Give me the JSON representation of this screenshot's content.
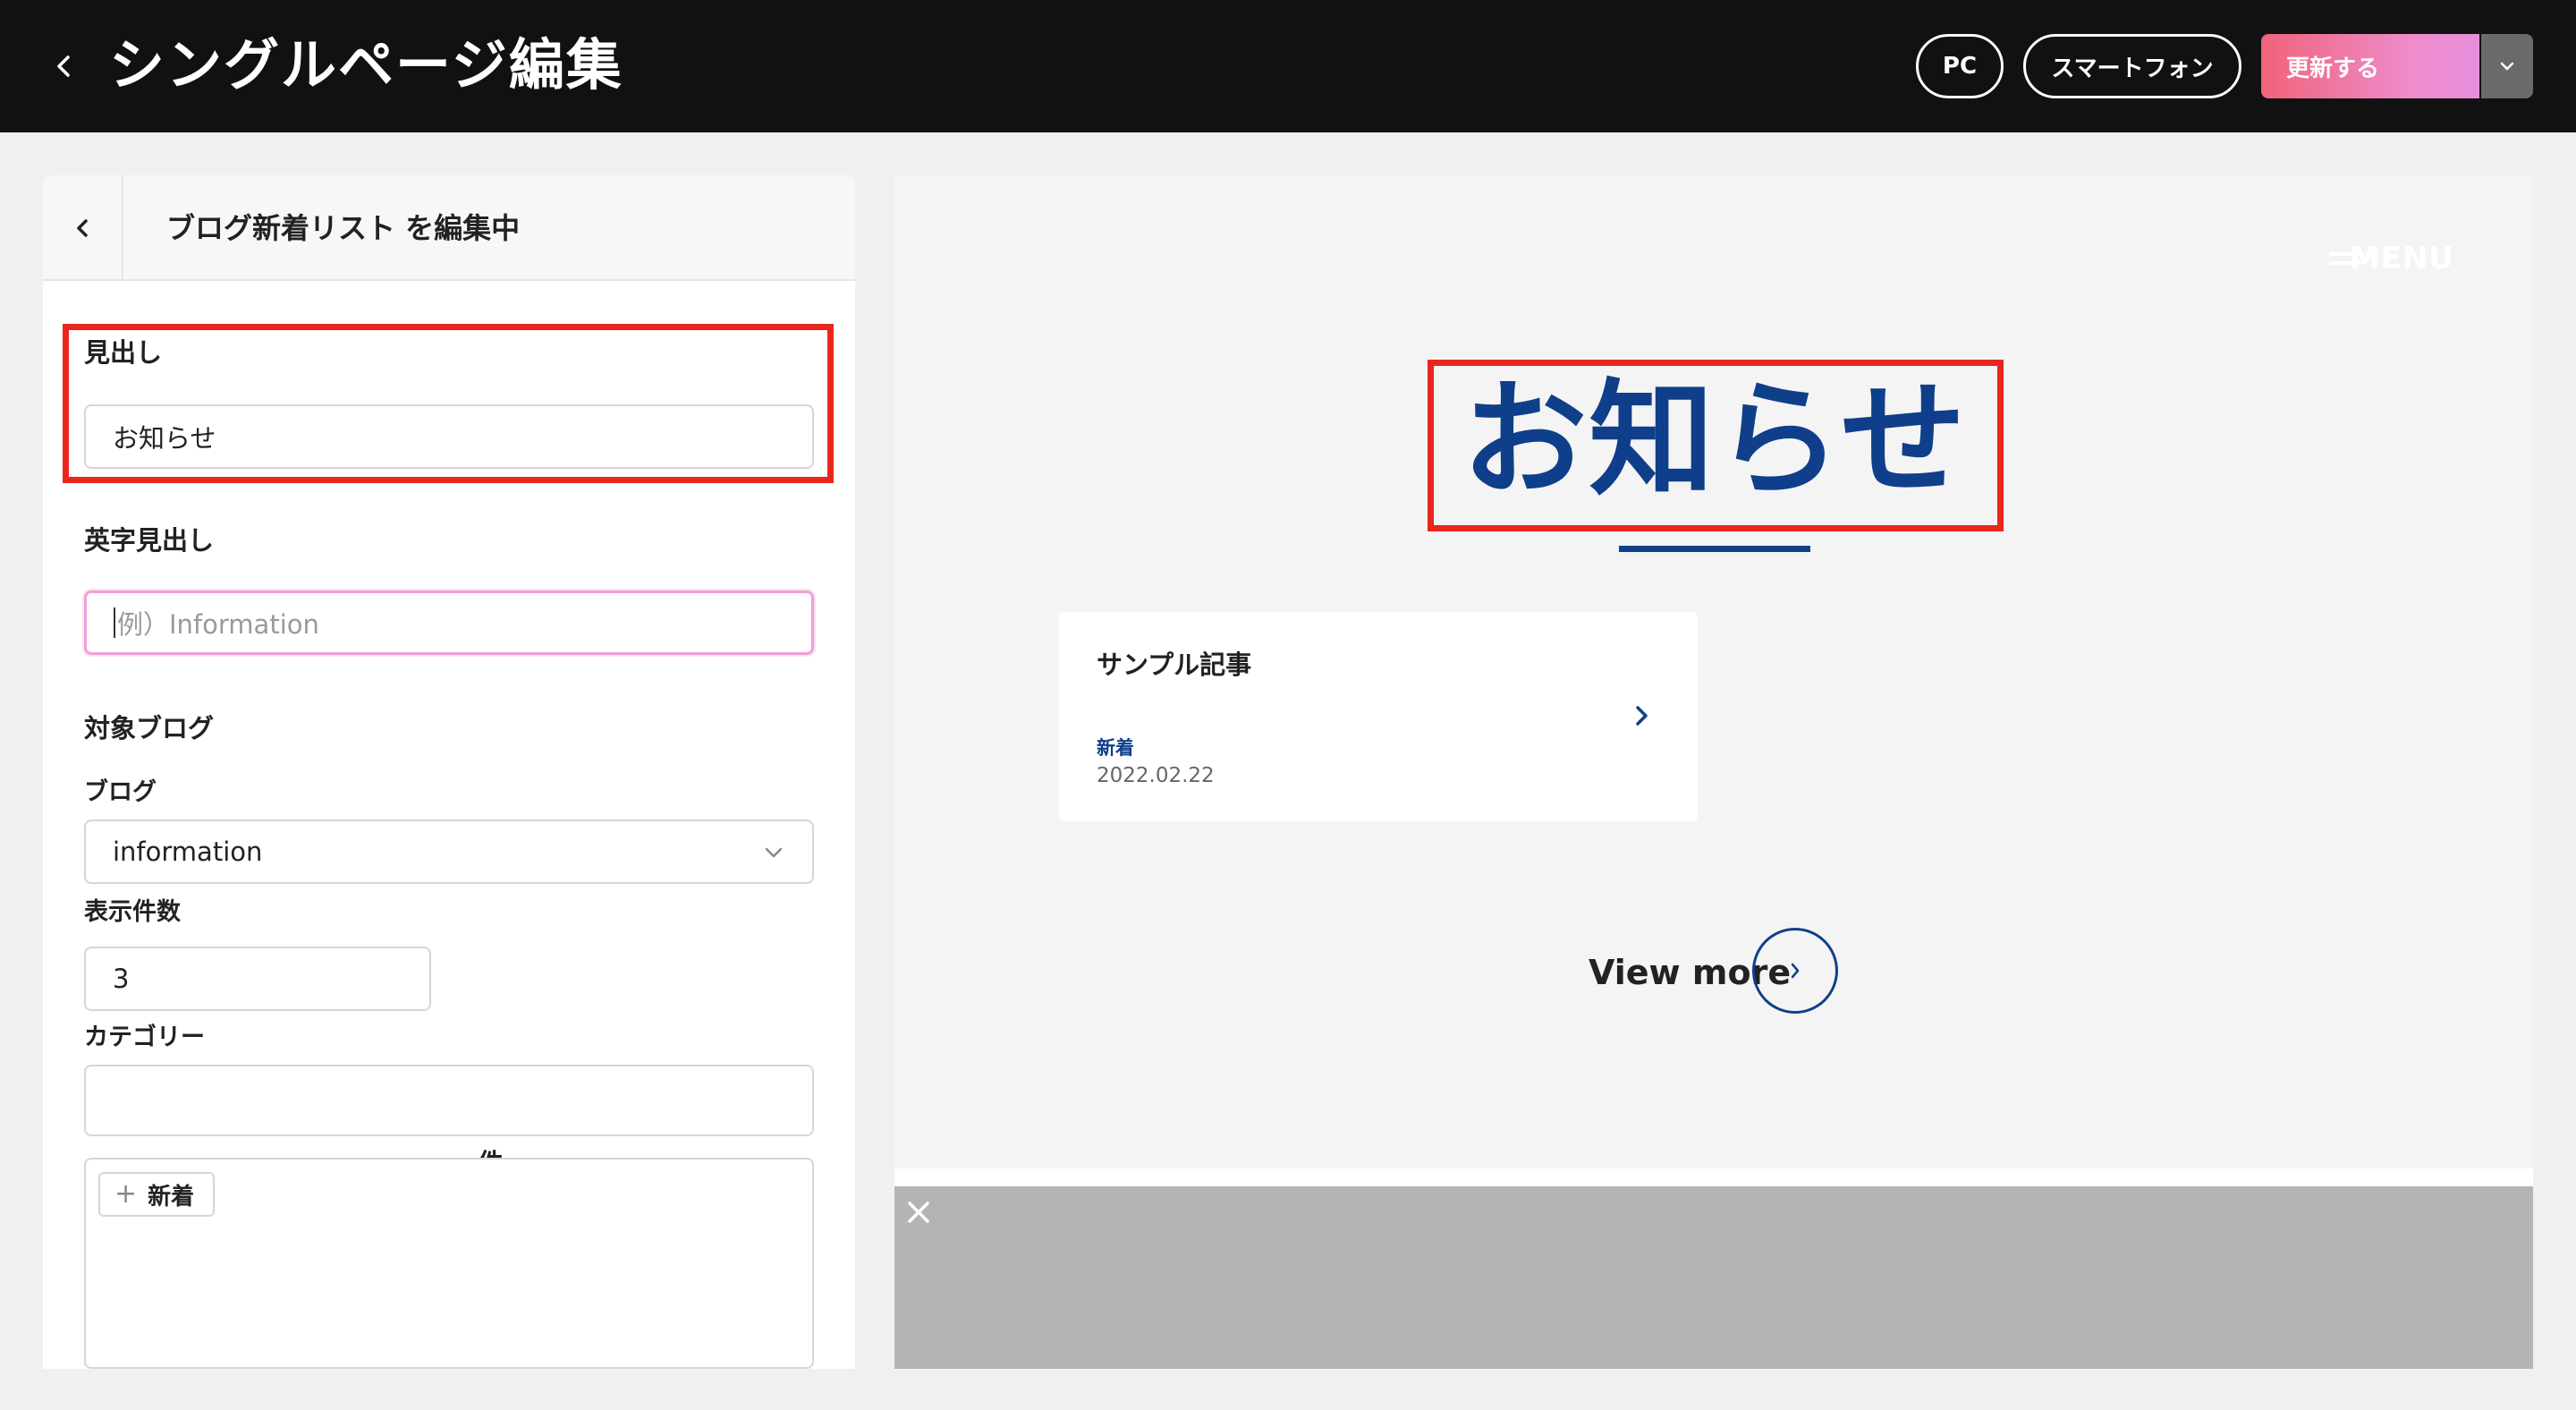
{
  "header": {
    "title": "シングルページ編集",
    "view_pc": "PC",
    "view_smartphone": "スマートフォン",
    "update_label": "更新する"
  },
  "editor": {
    "title": "ブログ新着リスト を編集中",
    "heading_label": "見出し",
    "heading_value": "お知らせ",
    "en_heading_label": "英字見出し",
    "en_heading_placeholder": "例）Information",
    "target_blog_label": "対象ブログ",
    "blog_label": "ブログ",
    "blog_selected": "information",
    "count_label": "表示件数",
    "count_value": "3",
    "count_unit": "件",
    "category_label": "カテゴリー",
    "category_value": "",
    "category_tag": "新着"
  },
  "preview": {
    "menu_label": "MENU",
    "heading": "お知らせ",
    "card": {
      "title": "サンプル記事",
      "tag": "新着",
      "date": "2022.02.22"
    },
    "view_more": "View more"
  },
  "colors": {
    "accent_navy": "#0f3f8a",
    "highlight_red": "#e8261e",
    "update_gradient_start": "#f0637a",
    "update_gradient_end": "#e88fdc"
  }
}
